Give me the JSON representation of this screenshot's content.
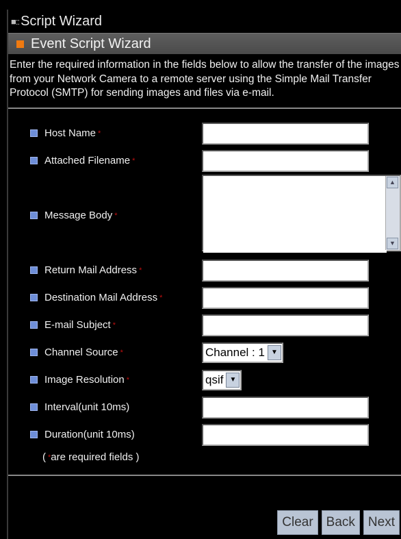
{
  "window": {
    "title": "Script Wizard"
  },
  "panel": {
    "header": "Event Script Wizard",
    "description": "Enter the required information in the fields below to allow the transfer of the images from your Network Camera to a remote server using the Simple Mail Transfer Protocol (SMTP) for sending images and files via e-mail."
  },
  "form": {
    "required_marker": "*",
    "fields": [
      {
        "label": "Host Name",
        "value": ""
      },
      {
        "label": "Attached Filename",
        "value": ""
      },
      {
        "label": "Message Body",
        "value": ""
      },
      {
        "label": "Return Mail Address",
        "value": ""
      },
      {
        "label": "Destination Mail Address",
        "value": ""
      },
      {
        "label": "E-mail Subject",
        "value": ""
      },
      {
        "label": "Channel Source",
        "value": "Channel : 1"
      },
      {
        "label": "Image Resolution",
        "value": "qsif"
      },
      {
        "label": "Interval(unit 10ms)",
        "value": ""
      },
      {
        "label": "Duration(unit 10ms)",
        "value": ""
      }
    ],
    "note_open": "(",
    "note_text": " are required fields )"
  },
  "buttons": {
    "clear": "Clear",
    "back": "Back",
    "next": "Next"
  },
  "colors": {
    "accent_orange": "#f07a10",
    "bullet_blue": "#6e8ed8",
    "required_red": "#c01010",
    "button_bg": "#b9c4d4"
  }
}
